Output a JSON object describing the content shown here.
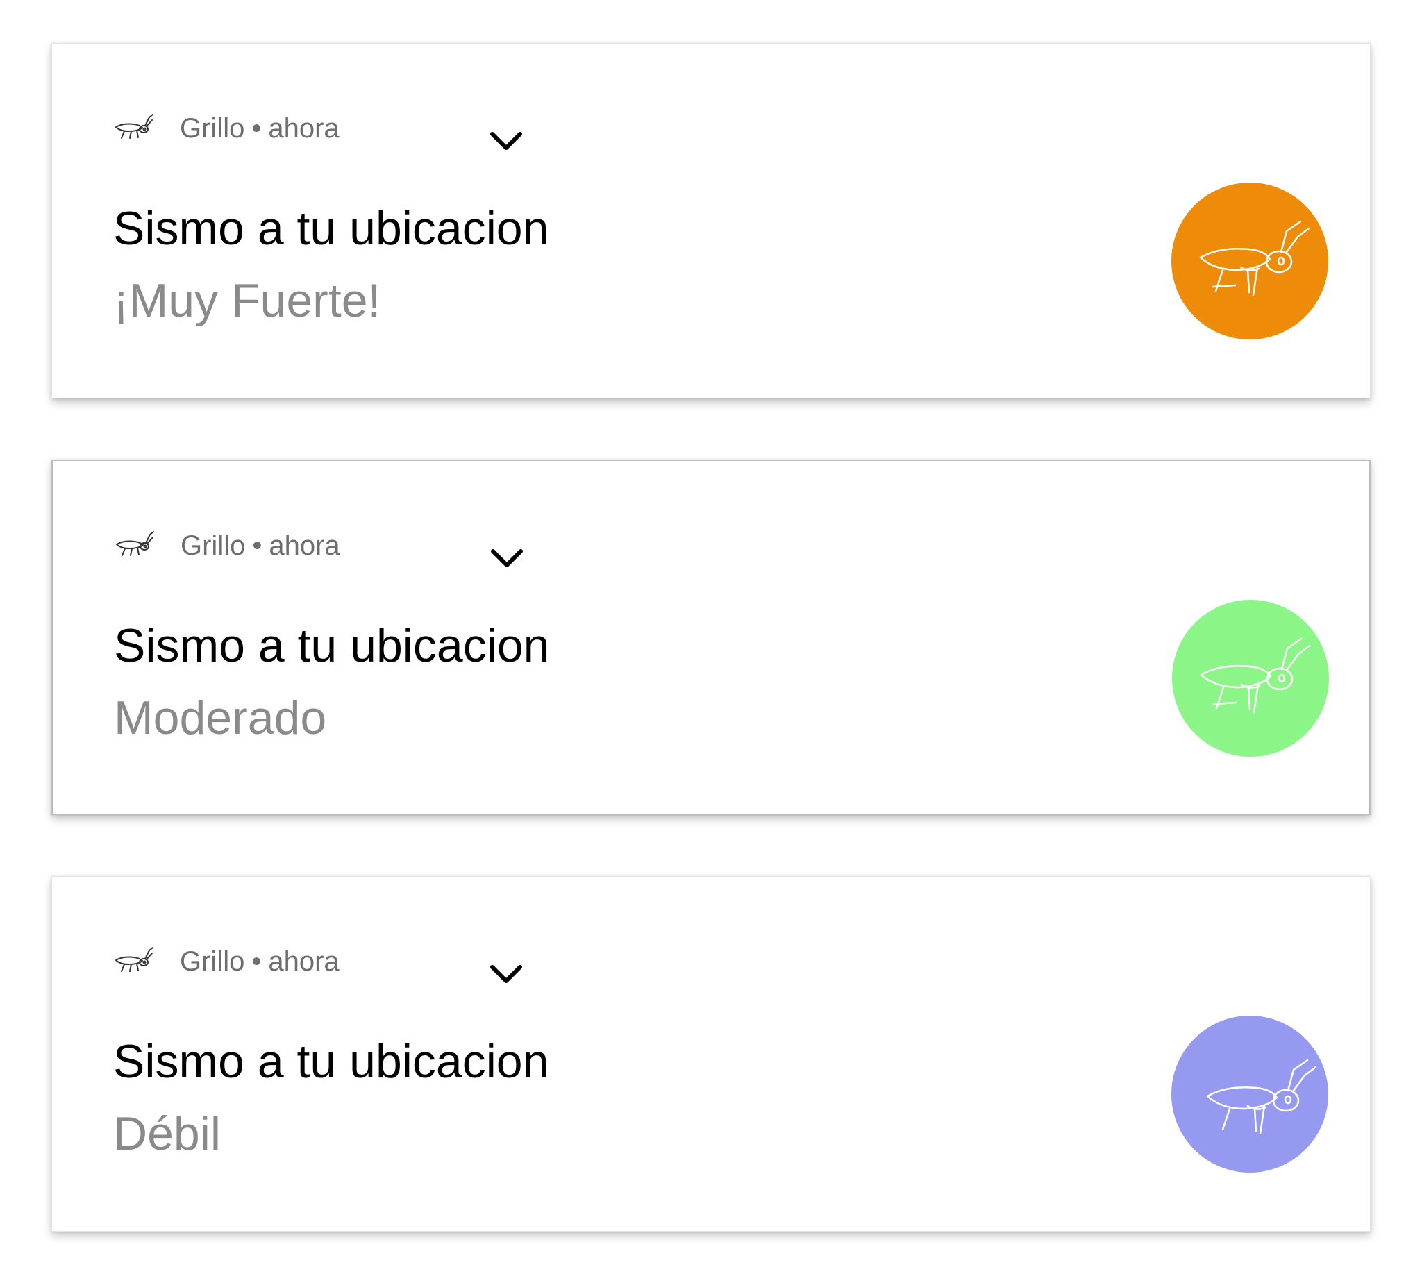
{
  "notifications": [
    {
      "app_name": "Grillo",
      "separator": "•",
      "time": "ahora",
      "title": "Sismo a tu ubicacion",
      "subtitle": "¡Muy Fuerte!",
      "color": "#EE8C0A"
    },
    {
      "app_name": "Grillo",
      "separator": "•",
      "time": "ahora",
      "title": "Sismo a tu ubicacion",
      "subtitle": "Moderado",
      "color": "#8BF588"
    },
    {
      "app_name": "Grillo",
      "separator": "•",
      "time": "ahora",
      "title": "Sismo a tu ubicacion",
      "subtitle": "Débil",
      "color": "#959AF0"
    }
  ],
  "icons": {
    "app_icon": "cricket-icon",
    "expand_icon": "chevron-down-icon",
    "avatar_icon": "cricket-icon"
  }
}
